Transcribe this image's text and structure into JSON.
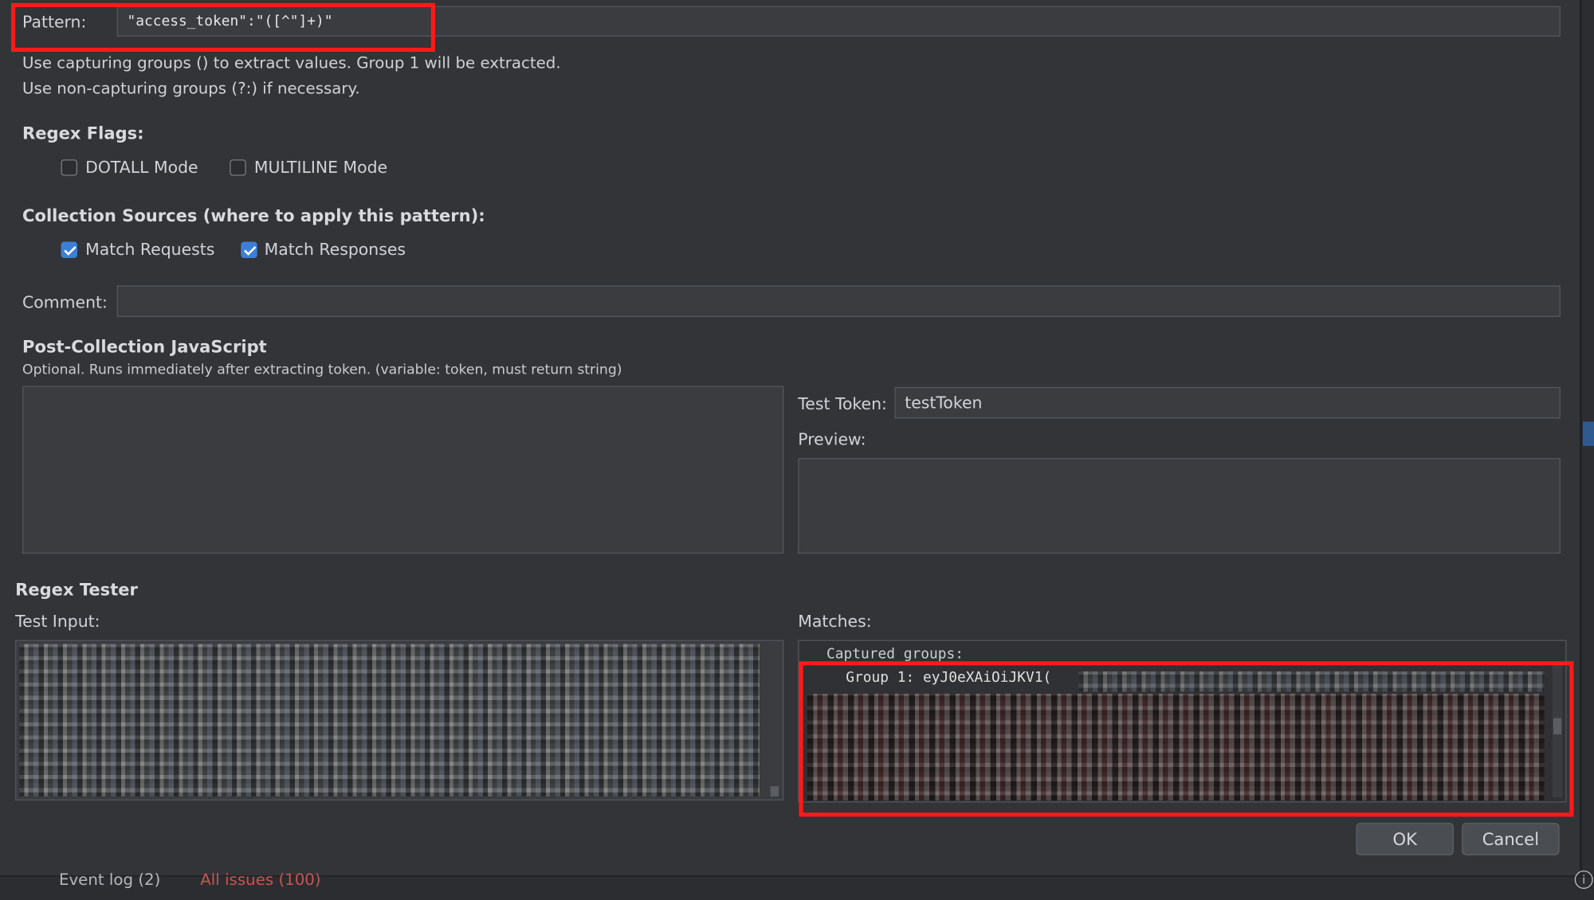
{
  "pattern": {
    "label": "Pattern:",
    "value": "\"access_token\":\"([^\"]+)\"",
    "hint_line1": "Use capturing groups () to extract values. Group 1 will be extracted.",
    "hint_line2": "Use non-capturing groups (?:) if necessary."
  },
  "regex_flags": {
    "title": "Regex Flags:",
    "dotall": {
      "label": "DOTALL Mode",
      "checked": false
    },
    "multiline": {
      "label": "MULTILINE Mode",
      "checked": false
    }
  },
  "collection_sources": {
    "title": "Collection Sources (where to apply this pattern):",
    "requests": {
      "label": "Match Requests",
      "checked": true
    },
    "responses": {
      "label": "Match Responses",
      "checked": true
    }
  },
  "comment": {
    "label": "Comment:",
    "value": ""
  },
  "post_collection": {
    "title": "Post-Collection JavaScript",
    "hint": "Optional. Runs immediately after extracting token. (variable: token, must return string)",
    "script": "",
    "test_token_label": "Test Token:",
    "test_token_value": "testToken",
    "preview_label": "Preview:",
    "preview_value": ""
  },
  "regex_tester": {
    "title": "Regex Tester",
    "test_input_label": "Test Input:",
    "matches_label": "Matches:",
    "captured_groups": "Captured groups:",
    "group1": "Group 1: eyJ0eXAiOiJKV1("
  },
  "buttons": {
    "ok": "OK",
    "cancel": "Cancel"
  },
  "statusbar": {
    "event_log": "Event log (2)",
    "all_issues": "All issues (100)"
  },
  "colors": {
    "background": "#323437",
    "highlight": "#ff1a1a",
    "checkbox_on": "#3d7fd6",
    "issues_text": "#c75450"
  }
}
